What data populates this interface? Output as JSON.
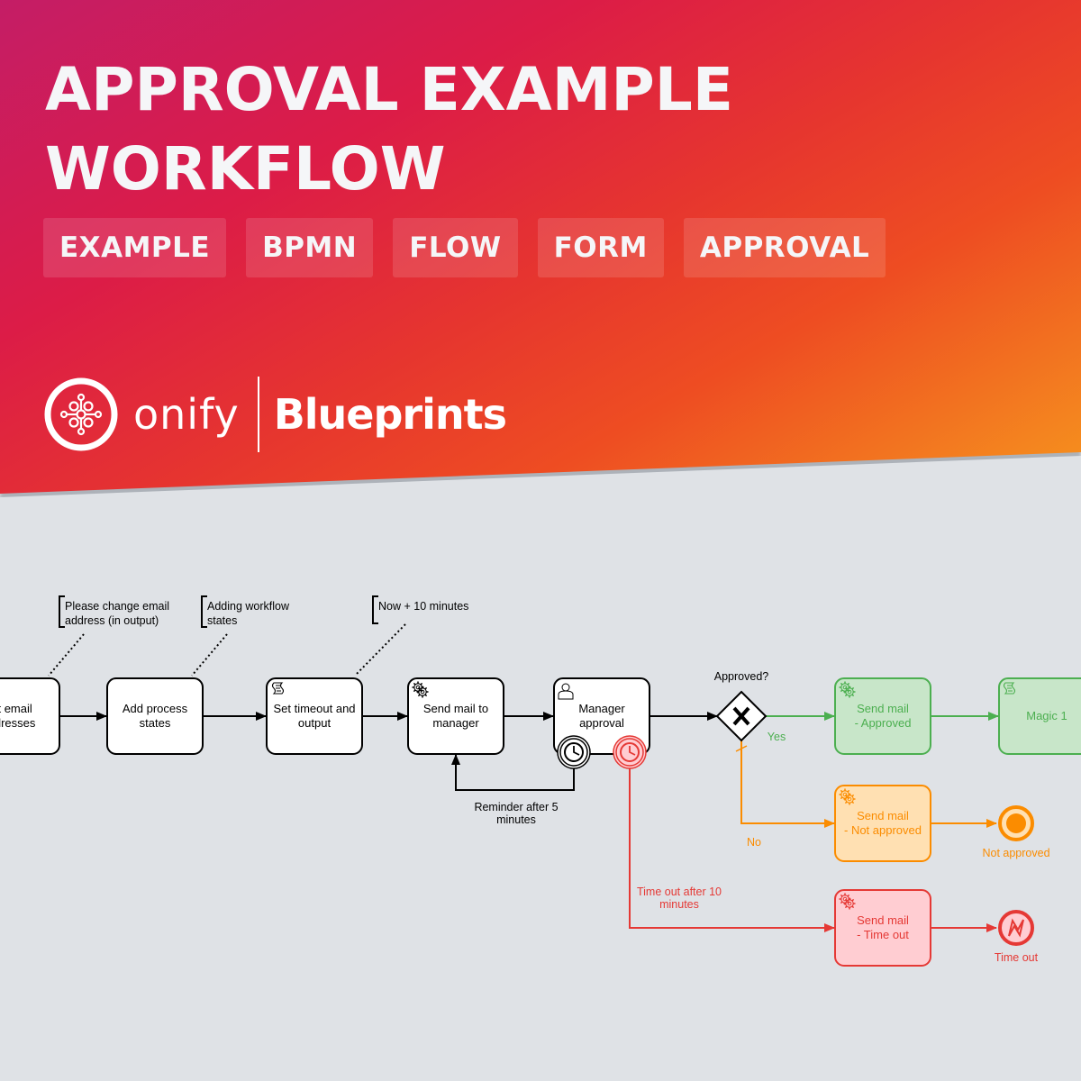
{
  "header": {
    "title_line1": "APPROVAL EXAMPLE",
    "title_line2": "WORKFLOW",
    "tags": [
      "EXAMPLE",
      "BPMN",
      "FLOW",
      "FORM",
      "APPROVAL"
    ]
  },
  "brand": {
    "logo_icon": "onify-network-icon",
    "name": "onify",
    "product": "Blueprints"
  },
  "colors": {
    "background": "#dfe2e6",
    "default_stroke": "#000000",
    "approved_green": "#4caf50",
    "approved_fill": "#c8e6c9",
    "not_approved_orange": "#fb8c00",
    "not_approved_fill": "#ffe0b2",
    "timeout_red": "#e53935",
    "timeout_fill": "#ffcdd2"
  },
  "diagram": {
    "annotations": [
      {
        "line1": "Please change email",
        "line2": "address (in output)"
      },
      {
        "line1": "Adding workflow",
        "line2": "states"
      },
      {
        "line1": "Now + 10 minutes",
        "line2": ""
      }
    ],
    "tasks": {
      "get_email": {
        "line1": "et email",
        "line2": "ddresses",
        "icon": ""
      },
      "add_states": {
        "line1": "Add process",
        "line2": "states",
        "icon": ""
      },
      "set_timeout": {
        "line1": "Set timeout and",
        "line2": "output",
        "icon": "script-icon"
      },
      "send_manager": {
        "line1": "Send mail to",
        "line2": "manager",
        "icon": "gear-icon"
      },
      "manager_approval": {
        "line1": "Manager",
        "line2": "approval",
        "icon": "user-icon"
      },
      "send_approved": {
        "line1": "Send mail",
        "line2": "- Approved",
        "icon": "gear-icon"
      },
      "magic": {
        "line1": "Magic 1",
        "line2": "",
        "icon": "script-icon"
      },
      "send_not_approved": {
        "line1": "Send mail",
        "line2": "- Not approved",
        "icon": "gear-icon"
      },
      "send_timeout": {
        "line1": "Send mail",
        "line2": "- Time out",
        "icon": "gear-icon"
      }
    },
    "gateway": {
      "label": "Approved?",
      "icon": "exclusive-x-icon"
    },
    "flows": {
      "yes": "Yes",
      "no": "No",
      "reminder_line1": "Reminder after 5",
      "reminder_line2": "minutes",
      "timeout_line1": "Time out after 10",
      "timeout_line2": "minutes"
    },
    "end_events": {
      "not_approved": "Not approved",
      "time_out": "Time out"
    }
  }
}
